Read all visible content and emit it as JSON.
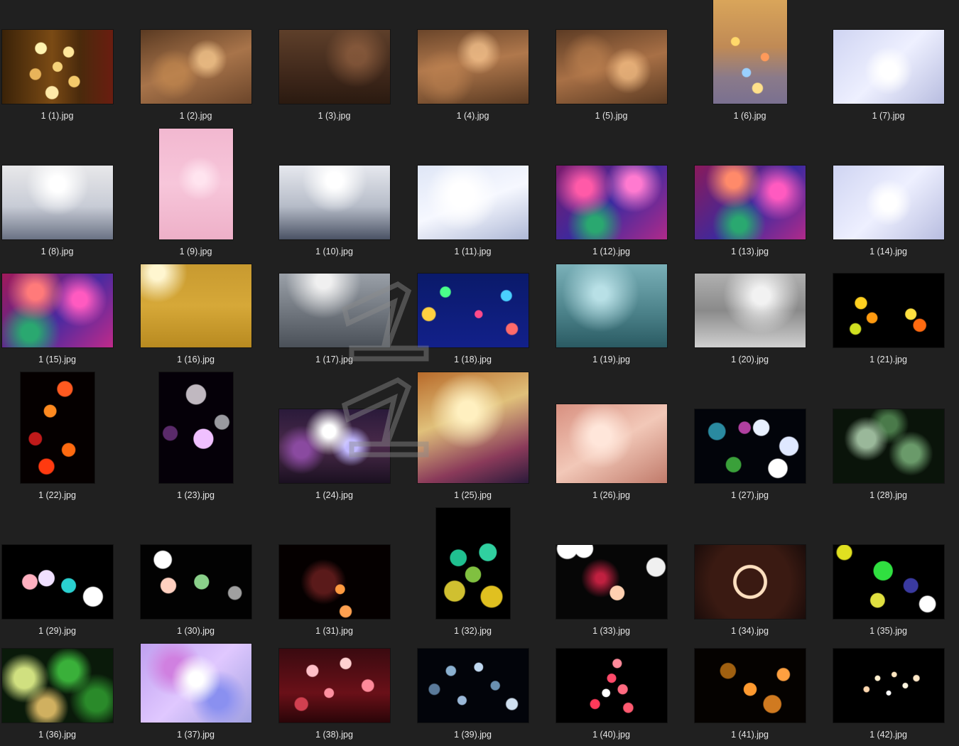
{
  "explorer": {
    "files": [
      {
        "name": "1 (1).jpg",
        "orient": "landscape",
        "bg": "radial-gradient(circle at 35% 25%, #fff3b0 0 6%, transparent 7%), radial-gradient(circle at 60% 30%, #ffe69a 0 6%, transparent 7%), radial-gradient(circle at 50% 50%, #f5d27a 0 7%, transparent 8%), radial-gradient(circle at 30% 60%, #e8b45a 0 6%, transparent 7%), radial-gradient(circle at 65% 70%, #f3c96b 0 6%, transparent 7%), radial-gradient(circle at 45% 85%, #ffe9a8 0 7%, transparent 8%), linear-gradient(90deg, #3a2208, #7a4a14 45%, #4a2a0c 70%, #6a1d10)"
      },
      {
        "name": "1 (2).jpg",
        "orient": "landscape",
        "bg": "radial-gradient(circle at 60% 40%, rgba(255,210,150,.7) 0 10%, transparent 25%), radial-gradient(circle at 30% 60%, rgba(200,140,80,.6) 0 12%, transparent 28%), linear-gradient(160deg, #5a3a22, #a8744a 50%, #6b452a)"
      },
      {
        "name": "1 (3).jpg",
        "orient": "landscape",
        "bg": "radial-gradient(circle at 70% 35%, rgba(180,120,80,.5) 0 10%, transparent 35%), linear-gradient(180deg, #5e3f2a, #3a2418 70%, #2a1a10)"
      },
      {
        "name": "1 (4).jpg",
        "orient": "landscape",
        "bg": "radial-gradient(circle at 55% 30%, rgba(255,205,150,.7) 0 10%, transparent 28%), radial-gradient(circle at 25% 65%, rgba(190,130,80,.6) 0 12%, transparent 30%), linear-gradient(170deg, #6a452a, #b0784c 45%, #5a3a22)"
      },
      {
        "name": "1 (5).jpg",
        "orient": "landscape",
        "bg": "radial-gradient(circle at 65% 55%, rgba(255,200,140,.7) 0 10%, transparent 28%), radial-gradient(circle at 30% 40%, rgba(190,130,80,.6) 0 12%, transparent 30%), linear-gradient(165deg, #5c3b24, #a87046 50%, #5a3a22)"
      },
      {
        "name": "1 (6).jpg",
        "orient": "portrait",
        "bg": "radial-gradient(circle at 30% 40%, #ffd86a 0 5%, transparent 6%), radial-gradient(circle at 70% 55%, #ff9a5a 0 5%, transparent 6%), radial-gradient(circle at 45% 70%, #9ad0ff 0 5%, transparent 6%), radial-gradient(circle at 60% 85%, #ffe08a 0 5%, transparent 6%), linear-gradient(180deg, #d9a55a, #c08a55 45%, #8a7a8a 75%, #7a7090)"
      },
      {
        "name": "1 (7).jpg",
        "orient": "landscape",
        "bg": "radial-gradient(circle at 50% 55%, #ffffff 0 12%, transparent 35%), linear-gradient(135deg, #cfd4f2, #eef0ff 50%, #b8bde0)"
      },
      {
        "name": "1 (8).jpg",
        "orient": "landscape",
        "bg": "radial-gradient(circle at 50% 25%, #ffffff 0 10%, transparent 40%), linear-gradient(180deg, #e8e8ea, #c8ccd6 55%, #6a7284)"
      },
      {
        "name": "1 (9).jpg",
        "orient": "portrait",
        "bg": "radial-gradient(circle at 55% 45%, #ffe4ef 0 8%, transparent 30%), linear-gradient(180deg, #f2b8d0, #f7c6da 50%, #eeb0c8)"
      },
      {
        "name": "1 (10).jpg",
        "orient": "landscape",
        "bg": "radial-gradient(circle at 50% 20%, #ffffff 0 10%, transparent 40%), linear-gradient(180deg, #e6e8ee, #b6bcc8 55%, #4a5264)"
      },
      {
        "name": "1 (11).jpg",
        "orient": "landscape",
        "bg": "radial-gradient(circle at 40% 40%, #ffffff 0 15%, transparent 45%), linear-gradient(160deg, #dfe6f6, #f6f8ff 50%, #aeb8d6)"
      },
      {
        "name": "1 (12).jpg",
        "orient": "landscape",
        "bg": "radial-gradient(circle at 25% 30%, #ff5aa8 0 8%, transparent 30%), radial-gradient(circle at 70% 25%, #ff7ad0 0 8%, transparent 30%), radial-gradient(circle at 35% 80%, #2aa870 0 8%, transparent 30%), linear-gradient(135deg, #7a1a6a, #3a2aa0 50%, #b02a8a)"
      },
      {
        "name": "1 (13).jpg",
        "orient": "landscape",
        "bg": "radial-gradient(circle at 35% 20%, #ff8a6a 0 8%, transparent 30%), radial-gradient(circle at 75% 35%, #ff5ac0 0 8%, transparent 30%), radial-gradient(circle at 40% 80%, #2aa870 0 8%, transparent 30%), linear-gradient(135deg, #8a1a5a, #3a2aa0 55%, #b02a8a)"
      },
      {
        "name": "1 (14).jpg",
        "orient": "landscape",
        "bg": "radial-gradient(circle at 50% 50%, #ffffff 0 12%, transparent 35%), linear-gradient(135deg, #cfd4f2, #eef0ff 50%, #b8bde0)"
      },
      {
        "name": "1 (15).jpg",
        "orient": "landscape",
        "bg": "radial-gradient(circle at 30% 25%, #ff7a7a 0 8%, transparent 30%), radial-gradient(circle at 70% 35%, #ff5ac0 0 8%, transparent 30%), radial-gradient(circle at 25% 80%, #2aa870 0 8%, transparent 30%), linear-gradient(135deg, #a01a5a, #4a2aa0 55%, #c02a8a)"
      },
      {
        "name": "1 (16).jpg",
        "orient": "landscape",
        "bg": "radial-gradient(circle at 15% 10%, #fff6d0 0 6%, transparent 25%), linear-gradient(180deg, #c89a30, #d6a838 50%, #b88a20)"
      },
      {
        "name": "1 (17).jpg",
        "orient": "landscape",
        "bg": "radial-gradient(circle at 40% 10%, #f0f0f0 0 8%, transparent 40%), linear-gradient(180deg, #9aa0a8, #6a7078 60%, #4a5058)"
      },
      {
        "name": "1 (18).jpg",
        "orient": "landscape",
        "bg": "radial-gradient(circle at 10% 55%, #ffd040 0 6%, transparent 7%), radial-gradient(circle at 25% 25%, #4aff8a 0 5%, transparent 6%), radial-gradient(circle at 55% 55%, #ff4a8a 0 5%, transparent 6%), radial-gradient(circle at 80% 30%, #4ad0ff 0 5%, transparent 6%), radial-gradient(circle at 85% 75%, #ff6a6a 0 5%, transparent 6%), linear-gradient(180deg, #0a1a6a, #12208a)"
      },
      {
        "name": "1 (19).jpg",
        "orient": "landscape",
        "bg": "radial-gradient(circle at 40% 35%, #b8e0e6 0 8%, transparent 45%), linear-gradient(180deg, #7ab0b8, #4a8088 60%, #2a5a62)"
      },
      {
        "name": "1 (20).jpg",
        "orient": "landscape",
        "bg": "radial-gradient(circle at 60% 30%, #f2f2f2 0 10%, transparent 45%), linear-gradient(180deg, #b0b0b0, #8a8a8a 50%, #d0d0d0)"
      },
      {
        "name": "1 (21).jpg",
        "orient": "landscape",
        "bg": "radial-gradient(circle at 25% 40%, #ffd020 0 6%, transparent 7%), radial-gradient(circle at 35% 60%, #ff9a10 0 6%, transparent 7%), radial-gradient(circle at 70% 55%, #ffe040 0 6%, transparent 7%), radial-gradient(circle at 78% 70%, #ff6a10 0 6%, transparent 7%), radial-gradient(circle at 20% 75%, #d0e020 0 5%, transparent 6%), #000"
      },
      {
        "name": "1 (22).jpg",
        "orient": "portrait",
        "bg": "radial-gradient(circle at 60% 15%, #ff5a20 0 7%, transparent 8%), radial-gradient(circle at 40% 35%, #ff8a20 0 7%, transparent 8%), radial-gradient(circle at 65% 70%, #ff6a10 0 7%, transparent 8%), radial-gradient(circle at 35% 85%, #ff3a10 0 7%, transparent 8%), radial-gradient(circle at 20% 60%, #c01a1a 0 7%, transparent 8%), #050000"
      },
      {
        "name": "1 (23).jpg",
        "orient": "portrait",
        "bg": "radial-gradient(circle at 60% 60%, #f0c0ff 0 12%, transparent 13%), radial-gradient(circle at 50% 20%, #c0b8c0 0 10%, transparent 11%), radial-gradient(circle at 85% 45%, #9a9aa0 0 8%, transparent 9%), radial-gradient(circle at 15% 55%, #5a2a6a 0 8%, transparent 9%), #050008"
      },
      {
        "name": "1 (24).jpg",
        "orient": "landscape",
        "bg": "radial-gradient(circle at 45% 30%, #ffffff 0 8%, transparent 30%), radial-gradient(circle at 65% 50%, #c0b8ff 0 8%, transparent 25%), radial-gradient(circle at 20% 55%, #8a4aa0 0 8%, transparent 25%), linear-gradient(180deg, #2a1a3a, #4a2a4a 50%, #1a1020)"
      },
      {
        "name": "1 (25).jpg",
        "orient": "portrait",
        "bg": "radial-gradient(circle at 45% 35%, #fff0c0 0 10%, transparent 40%), linear-gradient(160deg, #b86a2a, #e0c07a 40%, #8a3a5a 75%, #2a1a3a)"
      },
      {
        "name": "1 (26).jpg",
        "orient": "landscape",
        "bg": "radial-gradient(circle at 40% 40%, #ffe6da 0 12%, transparent 40%), linear-gradient(150deg, #d89080, #f2c8b8 50%, #c07a6a)"
      },
      {
        "name": "1 (27).jpg",
        "orient": "landscape",
        "bg": "radial-gradient(circle at 60% 25%, #e8f0ff 0 9%, transparent 10%), radial-gradient(circle at 85% 50%, #dfe8ff 0 9%, transparent 10%), radial-gradient(circle at 75% 80%, #ffffff 0 9%, transparent 10%), radial-gradient(circle at 20% 30%, #2a8aa0 0 8%, transparent 9%), radial-gradient(circle at 35% 75%, #3aa03a 0 8%, transparent 9%), radial-gradient(circle at 45% 25%, #b040a0 0 7%, transparent 8%), #02040a"
      },
      {
        "name": "1 (28).jpg",
        "orient": "landscape",
        "bg": "radial-gradient(circle at 30% 40%, #9ab89a 0 10%, transparent 25%), radial-gradient(circle at 70% 60%, #6a9a6a 0 10%, transparent 25%), radial-gradient(circle at 50% 20%, #4a7a4a 0 10%, transparent 25%), #0a140a"
      },
      {
        "name": "1 (29).jpg",
        "orient": "landscape",
        "bg": "radial-gradient(circle at 40% 45%, #f0e0ff 0 10%, transparent 11%), radial-gradient(circle at 60% 55%, #2ad0d0 0 9%, transparent 10%), radial-gradient(circle at 82% 70%, #ffffff 0 9%, transparent 10%), radial-gradient(circle at 25% 50%, #ffb0c0 0 8%, transparent 9%), #000"
      },
      {
        "name": "1 (30).jpg",
        "orient": "landscape",
        "bg": "radial-gradient(circle at 20% 20%, #ffffff 0 8%, transparent 9%), radial-gradient(circle at 55% 50%, #8ad08a 0 10%, transparent 11%), radial-gradient(circle at 85% 65%, #a0a0a0 0 6%, transparent 7%), radial-gradient(circle at 25% 55%, #ffd0c0 0 8%, transparent 9%), #020202"
      },
      {
        "name": "1 (31).jpg",
        "orient": "landscape",
        "bg": "radial-gradient(circle at 55% 60%, #ff9a40 0 6%, transparent 7%), radial-gradient(circle at 60% 90%, #ffa050 0 6%, transparent 7%), radial-gradient(circle at 40% 50%, #5a1a1a 0 15%, transparent 30%), #050000"
      },
      {
        "name": "1 (32).jpg",
        "orient": "portrait",
        "bg": "radial-gradient(circle at 30% 45%, #20c090 0 10%, transparent 11%), radial-gradient(circle at 70% 40%, #30d0a0 0 10%, transparent 11%), radial-gradient(circle at 25% 75%, #d0c030 0 10%, transparent 11%), radial-gradient(circle at 75% 80%, #e0c020 0 10%, transparent 11%), radial-gradient(circle at 50% 60%, #80c040 0 10%, transparent 11%), #000"
      },
      {
        "name": "1 (33).jpg",
        "orient": "landscape",
        "bg": "radial-gradient(circle at 10% 5%, #ffffff 0 8%, transparent 9%), radial-gradient(circle at 25% 5%, #ffffff 0 8%, transparent 9%), radial-gradient(circle at 55% 65%, #ffd0b0 0 9%, transparent 10%), radial-gradient(circle at 90% 30%, #f0f0f0 0 8%, transparent 9%), radial-gradient(circle at 40% 45%, #c02040 0 6%, transparent 25%), #060606"
      },
      {
        "name": "1 (34).jpg",
        "orient": "landscape",
        "bg": "radial-gradient(circle at 50% 50%, transparent 0 20%, #ffe0c0 21% 25%, transparent 26%), radial-gradient(circle at 50% 50%, #3a1a12 0 60%, #1a0c0a)"
      },
      {
        "name": "1 (35).jpg",
        "orient": "landscape",
        "bg": "radial-gradient(circle at 45% 35%, #30e040 0 12%, transparent 13%), radial-gradient(circle at 40% 75%, #e0e040 0 8%, transparent 9%), radial-gradient(circle at 85% 80%, #ffffff 0 7%, transparent 8%), radial-gradient(circle at 10% 10%, #e0e020 0 6%, transparent 7%), radial-gradient(circle at 70% 55%, #3a3aa0 0 8%, transparent 9%), #000"
      },
      {
        "name": "1 (36).jpg",
        "orient": "landscape",
        "bg": "radial-gradient(circle at 20% 40%, #d0e080 0 10%, transparent 25%), radial-gradient(circle at 60% 30%, #3ab03a 0 12%, transparent 28%), radial-gradient(circle at 40% 80%, #d0b060 0 10%, transparent 25%), radial-gradient(circle at 85% 70%, #2a8a2a 0 10%, transparent 25%), #0a1a0a"
      },
      {
        "name": "1 (37).jpg",
        "orient": "landscape",
        "bg": "radial-gradient(circle at 50% 45%, #ffffff 0 10%, transparent 35%), radial-gradient(circle at 30% 30%, #d080e0 0 10%, transparent 30%), radial-gradient(circle at 70% 70%, #8a90f0 0 10%, transparent 30%), linear-gradient(135deg, #c0a0f0, #e0c8ff 50%, #a0a0e0)"
      },
      {
        "name": "1 (38).jpg",
        "orient": "landscape",
        "bg": "radial-gradient(circle at 30% 30%, #ffc0c8 0 6%, transparent 7%), radial-gradient(circle at 60% 20%, #ffd0d0 0 6%, transparent 7%), radial-gradient(circle at 45% 60%, #ff90a0 0 6%, transparent 7%), radial-gradient(circle at 80% 50%, #ff8a9a 0 6%, transparent 7%), radial-gradient(circle at 20% 75%, #d04050 0 6%, transparent 7%), linear-gradient(180deg, #3a0a10, #6a1018 60%, #2a0508)"
      },
      {
        "name": "1 (39).jpg",
        "orient": "landscape",
        "bg": "radial-gradient(circle at 30% 30%, #8ab0d0 0 5%, transparent 6%), radial-gradient(circle at 55% 25%, #c0d8f0 0 5%, transparent 6%), radial-gradient(circle at 70% 50%, #6a90b0 0 5%, transparent 6%), radial-gradient(circle at 40% 70%, #9ab8d8 0 5%, transparent 6%), radial-gradient(circle at 85% 75%, #d0e0f0 0 5%, transparent 6%), radial-gradient(circle at 15% 55%, #5a7a9a 0 5%, transparent 6%), #02040a"
      },
      {
        "name": "1 (40).jpg",
        "orient": "landscape",
        "bg": "radial-gradient(circle at 50% 40%, #ff4a6a 0 6%, transparent 7%), radial-gradient(circle at 45% 60%, #ffffff 0 5%, transparent 6%), radial-gradient(circle at 60% 55%, #ff6a80 0 6%, transparent 7%), radial-gradient(circle at 35% 75%, #ff3a5a 0 5%, transparent 6%), radial-gradient(circle at 65% 80%, #ff5a70 0 5%, transparent 6%), radial-gradient(circle at 55% 20%, #ff8a9a 0 5%, transparent 6%), #000"
      },
      {
        "name": "1 (41).jpg",
        "orient": "landscape",
        "bg": "radial-gradient(circle at 50% 55%, #ff9a30 0 9%, transparent 10%), radial-gradient(circle at 70% 75%, #d07a20 0 9%, transparent 10%), radial-gradient(circle at 30% 30%, #a06010 0 8%, transparent 9%), radial-gradient(circle at 80% 35%, #ffa040 0 6%, transparent 7%), #050200"
      },
      {
        "name": "1 (42).jpg",
        "orient": "landscape",
        "bg": "radial-gradient(circle at 40% 40%, #fff0d0 0 3%, transparent 4%), radial-gradient(circle at 55% 35%, #ffe6c0 0 3%, transparent 4%), radial-gradient(circle at 65% 50%, #fff6e0 0 3%, transparent 4%), radial-gradient(circle at 30% 55%, #ffd8b0 0 3%, transparent 4%), radial-gradient(circle at 50% 60%, #ffffff 0 3%, transparent 4%), radial-gradient(circle at 75% 40%, #ffe8c8 0 3%, transparent 4%), #000"
      }
    ]
  }
}
